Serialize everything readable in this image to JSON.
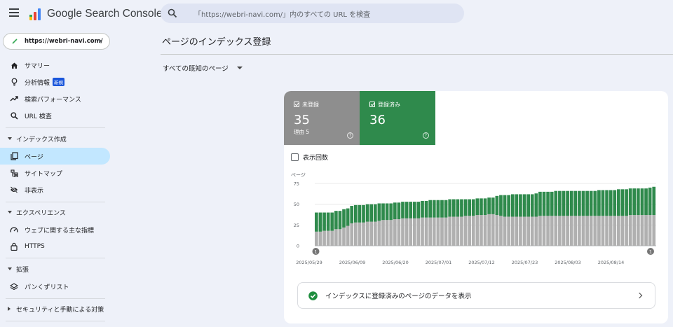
{
  "app": {
    "title": "Google Search Console",
    "search_placeholder": "「https://webri-navi.com/」内のすべての URL を検査"
  },
  "property": {
    "url": "https://webri-navi.com/"
  },
  "sidebar": {
    "items": [
      {
        "label": "サマリー",
        "icon": "home-icon"
      },
      {
        "label": "分析情報",
        "icon": "lightbulb-icon",
        "badge": "新規"
      },
      {
        "label": "検索パフォーマンス",
        "icon": "trending-up-icon"
      },
      {
        "label": "URL 検査",
        "icon": "search-icon"
      }
    ],
    "index_section": {
      "label": "インデックス作成",
      "items": [
        {
          "label": "ページ",
          "icon": "pages-icon",
          "active": true
        },
        {
          "label": "サイトマップ",
          "icon": "sitemap-icon"
        },
        {
          "label": "非表示",
          "icon": "eye-off-icon"
        }
      ]
    },
    "experience_section": {
      "label": "エクスペリエンス",
      "items": [
        {
          "label": "ウェブに関する主な指標",
          "icon": "speed-icon"
        },
        {
          "label": "HTTPS",
          "icon": "lock-icon"
        }
      ]
    },
    "enhancements_section": {
      "label": "拡張",
      "items": [
        {
          "label": "パンくずリスト",
          "icon": "layers-icon"
        }
      ]
    },
    "security_section": {
      "label": "セキュリティと手動による対策"
    }
  },
  "main": {
    "page_title": "ページのインデックス登録",
    "filter_label": "すべての既知のページ",
    "tiles": {
      "not_indexed": {
        "label": "未登録",
        "value": "35",
        "sub": "理由 5",
        "color": "#8e8e8e"
      },
      "indexed": {
        "label": "登録済み",
        "value": "36",
        "color": "#2f8a4c"
      }
    },
    "impressions_label": "表示回数",
    "view_data_label": "インデックスに登録済みのページのデータを表示"
  },
  "chart_data": {
    "type": "bar",
    "stacked": true,
    "ylabel": "ページ",
    "ylim": [
      0,
      75
    ],
    "yticks": [
      0,
      25,
      50,
      75
    ],
    "xtick_labels": [
      "2025/05/29",
      "2025/06/09",
      "2025/06/20",
      "2025/07/01",
      "2025/07/12",
      "2025/07/23",
      "2025/08/03",
      "2025/08/14"
    ],
    "annotations": [
      {
        "label": "1",
        "date": "2025/05/29"
      },
      {
        "label": "1",
        "date": "2025/08/21"
      }
    ],
    "series": [
      {
        "name": "未登録",
        "color": "#b0b0b0",
        "values": [
          17,
          17,
          18,
          18,
          18,
          20,
          20,
          22,
          24,
          27,
          28,
          28,
          28,
          29,
          29,
          29,
          30,
          31,
          31,
          31,
          32,
          32,
          33,
          33,
          33,
          33,
          33,
          34,
          34,
          34,
          34,
          34,
          34,
          34,
          35,
          35,
          35,
          35,
          36,
          36,
          36,
          37,
          37,
          37,
          38,
          38,
          37,
          36,
          35,
          35,
          35,
          35,
          35,
          35,
          35,
          35,
          35,
          36,
          36,
          36,
          36,
          36,
          36,
          36,
          36,
          36,
          36,
          36,
          36,
          36,
          36,
          36,
          36,
          36,
          36,
          36,
          36,
          36,
          36,
          36,
          37,
          37,
          37,
          37,
          37,
          37,
          37
        ]
      },
      {
        "name": "登録済み",
        "color": "#2f8a4c",
        "values": [
          23,
          23,
          22,
          22,
          22,
          22,
          22,
          22,
          21,
          21,
          21,
          21,
          21,
          21,
          21,
          21,
          21,
          20,
          20,
          20,
          20,
          20,
          20,
          20,
          20,
          20,
          20,
          20,
          20,
          21,
          21,
          21,
          21,
          21,
          21,
          21,
          21,
          21,
          20,
          20,
          20,
          20,
          20,
          20,
          20,
          20,
          23,
          25,
          26,
          26,
          27,
          27,
          27,
          27,
          27,
          27,
          28,
          29,
          29,
          29,
          29,
          30,
          30,
          30,
          30,
          30,
          30,
          30,
          30,
          30,
          30,
          30,
          31,
          31,
          31,
          31,
          31,
          32,
          32,
          32,
          32,
          32,
          32,
          32,
          32,
          33,
          34
        ]
      }
    ]
  }
}
